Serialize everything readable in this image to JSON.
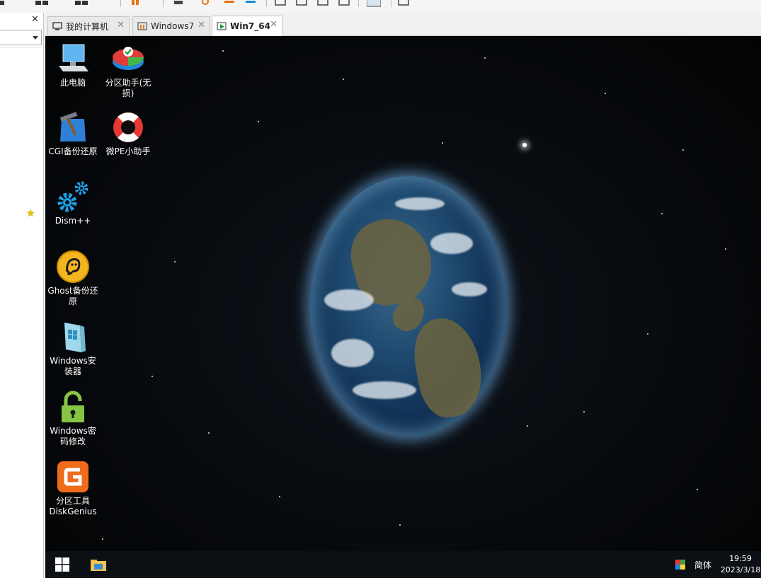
{
  "window": {
    "tabs": [
      {
        "label": "我的计算机",
        "active": false
      },
      {
        "label": "Windows7",
        "active": false
      },
      {
        "label": "Win7_64",
        "active": true
      }
    ],
    "close_glyph": "✕"
  },
  "left_panel": {
    "close_glyph": "✕",
    "star_glyph": "★"
  },
  "desktop": {
    "icons": [
      {
        "label": "此电脑",
        "icon": "computer-icon"
      },
      {
        "label": "分区助手(无损)",
        "icon": "partition-assistant-icon"
      },
      {
        "label": "CGI备份还原",
        "icon": "cgi-backup-icon"
      },
      {
        "label": "微PE小助手",
        "icon": "lifebuoy-icon"
      },
      {
        "label": "Dism++",
        "icon": "gears-icon"
      },
      {
        "label": "Ghost备份还原",
        "icon": "ghost-icon"
      },
      {
        "label": "Windows安装器",
        "icon": "windows-installer-icon"
      },
      {
        "label": "Windows密码修改",
        "icon": "padlock-icon"
      },
      {
        "label": "分区工具DiskGenius",
        "icon": "diskgenius-icon"
      }
    ]
  },
  "taskbar": {
    "language": "简体",
    "time": "19:59",
    "date": "2023/3/18"
  },
  "colors": {
    "accent_blue": "#1e90ff",
    "taskbar": "#0c0f14",
    "tab_active": "#ffffff"
  }
}
